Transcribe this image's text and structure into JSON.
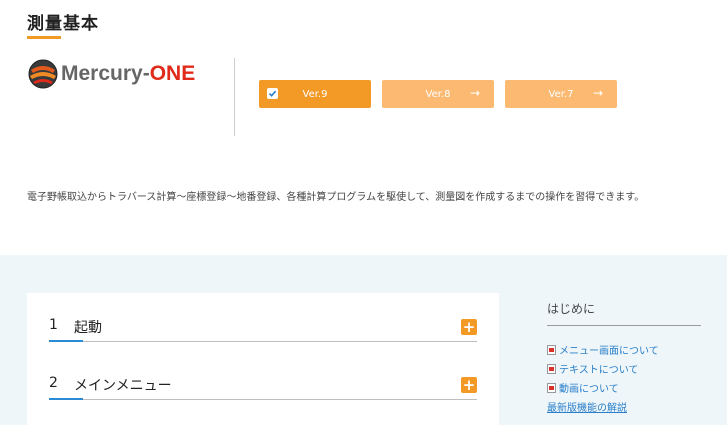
{
  "page": {
    "title": "測量基本"
  },
  "logo": {
    "text_main": "Mercury-",
    "text_accent": "ONE"
  },
  "versions": [
    {
      "label": "Ver.9",
      "active": true
    },
    {
      "label": "Ver.8",
      "active": false
    },
    {
      "label": "Ver.7",
      "active": false
    }
  ],
  "arrow": "→",
  "description": "電子野帳取込からトラバース計算〜座標登録〜地番登録、各種計算プログラムを駆使して、測量図を作成するまでの操作を習得できます。",
  "chapters": [
    {
      "num": "1",
      "title": "起動"
    },
    {
      "num": "2",
      "title": "メインメニュー"
    }
  ],
  "plus": "+",
  "sidebar": {
    "title": "はじめに",
    "links": [
      {
        "label": "メニュー画面について",
        "icon": "pdf-icon"
      },
      {
        "label": "テキストについて",
        "icon": "pdf-icon"
      },
      {
        "label": "動画について",
        "icon": "pdf-icon"
      },
      {
        "label": "最新版機能の解説",
        "icon": ""
      }
    ]
  },
  "colors": {
    "accent": "#f39a26",
    "accent_light": "#fbb972",
    "link": "#2a7fc8",
    "bottom_bg": "#eef6fa"
  }
}
